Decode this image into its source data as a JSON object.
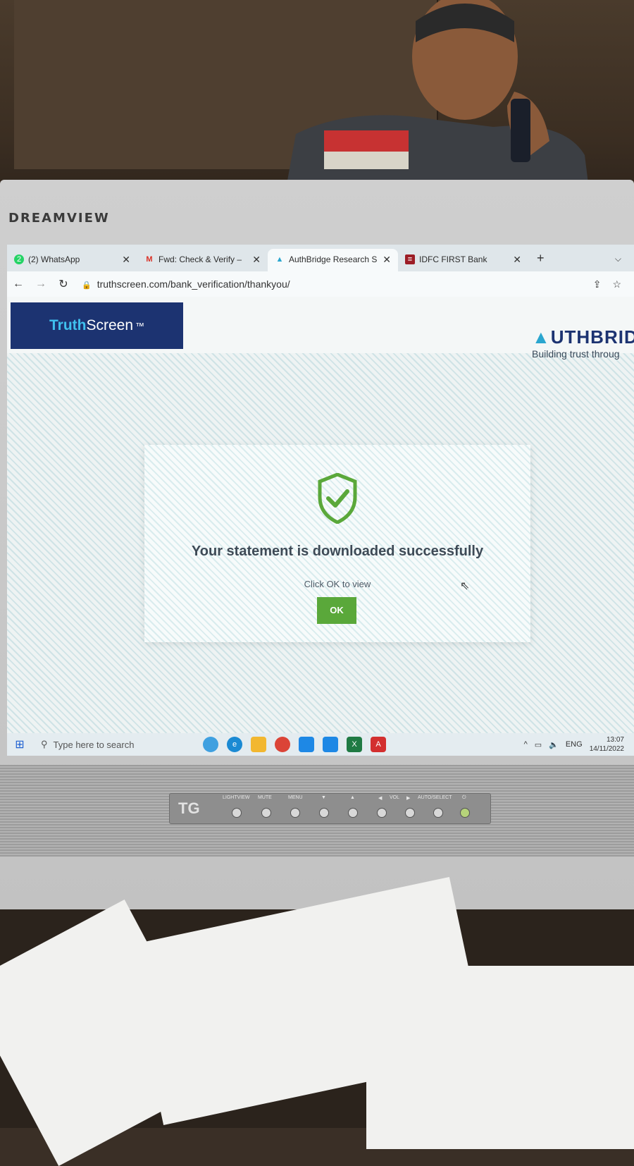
{
  "monitor": {
    "brand": "DREAMVIEW"
  },
  "browser": {
    "tabs": [
      {
        "label": "(2) WhatsApp",
        "badge": "2",
        "active": false
      },
      {
        "label": "Fwd: Check & Verify – ",
        "active": false
      },
      {
        "label": "AuthBridge Research S",
        "active": true
      },
      {
        "label": "IDFC FIRST Bank",
        "active": false
      }
    ],
    "new_tab": "+",
    "url": "truthscreen.com/bank_verification/thankyou/"
  },
  "header": {
    "truthscreen_logo": {
      "part1": "Truth",
      "part2": "Screen",
      "tm": "™"
    },
    "authbridge_logo": {
      "name": "UTHBRID",
      "tagline": "Building trust throug"
    }
  },
  "dialog": {
    "title": "Your statement is downloaded successfully",
    "subtitle": "Click OK to view",
    "ok_label": "OK",
    "accent_color": "#5aa83a"
  },
  "taskbar": {
    "search_placeholder": "Type here to search",
    "language": "ENG",
    "time": "13:07",
    "date": "14/11/2022"
  },
  "controls": {
    "badge": "TG",
    "labels": [
      "LIGHTVIEW",
      "MUTE",
      "MENU",
      "▼",
      "▲",
      "◀",
      "VOL",
      "▶",
      "AUTO/SELECT",
      "⏻"
    ]
  }
}
